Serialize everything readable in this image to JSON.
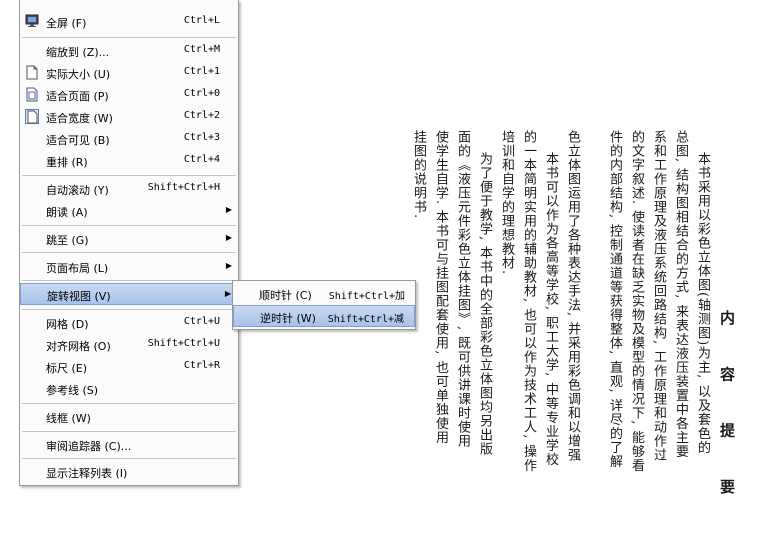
{
  "menu": {
    "items": [
      {
        "label": "全屏 (F)",
        "shortcut": "Ctrl+L",
        "icon": "monitor-icon"
      },
      {
        "label": "缩放到 (Z)...",
        "shortcut": "Ctrl+M"
      },
      {
        "label": "实际大小 (U)",
        "shortcut": "Ctrl+1",
        "icon": "page-icon"
      },
      {
        "label": "适合页面 (P)",
        "shortcut": "Ctrl+0",
        "icon": "page-icon"
      },
      {
        "label": "适合宽度 (W)",
        "shortcut": "Ctrl+2",
        "icon": "page-icon"
      },
      {
        "label": "适合可见 (B)",
        "shortcut": "Ctrl+3"
      },
      {
        "label": "重排 (R)",
        "shortcut": "Ctrl+4"
      },
      {
        "label": "自动滚动 (Y)",
        "shortcut": "Shift+Ctrl+H"
      },
      {
        "label": "朗读 (A)"
      },
      {
        "label": "跳至 (G)"
      },
      {
        "label": "页面布局 (L)"
      },
      {
        "label": "旋转视图 (V)"
      },
      {
        "label": "网格 (D)",
        "shortcut": "Ctrl+U"
      },
      {
        "label": "对齐网格 (O)",
        "shortcut": "Shift+Ctrl+U"
      },
      {
        "label": "标尺 (E)",
        "shortcut": "Ctrl+R"
      },
      {
        "label": "参考线 (S)"
      },
      {
        "label": "线框 (W)"
      },
      {
        "label": "审阅追踪器 (C)..."
      },
      {
        "label": "显示注释列表 (I)"
      }
    ]
  },
  "submenu": {
    "items": [
      {
        "label": "顺时针 (C)",
        "shortcut": "Shift+Ctrl+加"
      },
      {
        "label": "逆时针 (W)",
        "shortcut": "Shift+Ctrl+减"
      }
    ]
  },
  "document": {
    "heading": "内 容 提 要",
    "columns": [
      "本书采用以彩色立体图(轴测图)为主, 以及套色的",
      "总图, 结构图相结合的方式, 来表达液压装置中各主要",
      "系和工作原理及液压系统回路结构, 工作原理和动作过",
      "的文字叙述. 使读者在缺乏实物及模型的情况下, 能够看",
      "件的内部结构, 控制通道等获得整体, 直观, 详尽的了解",
      "色立体图运用了各种表达手法, 并采用彩色调和以增强",
      "本书可以作为各高等学校, 职工大学, 中等专业学校",
      "的一本简明实用的辅助教材, 也可以作为技术工人, 操作",
      "培训和自学的理想教材.",
      "为了便于教学, 本书中的全部彩色立体图均另出版",
      "面的《液压元件彩色立体挂图》, 既可供讲课时使用",
      "使学生自学. 本书可与挂图配套使用, 也可单独使用",
      "挂图的说明书."
    ]
  }
}
